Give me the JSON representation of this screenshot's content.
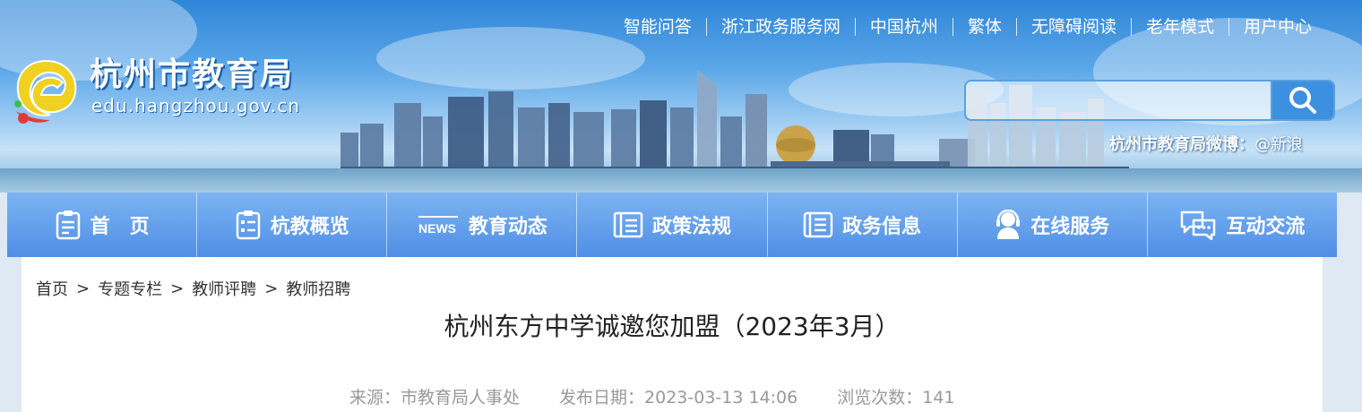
{
  "top_links": [
    "智能问答",
    "浙江政务服务网",
    "中国杭州",
    "繁体",
    "无障碍阅读",
    "老年模式",
    "用户中心"
  ],
  "logo": {
    "title": "杭州市教育局",
    "url": "edu.hangzhou.gov.cn"
  },
  "search": {
    "placeholder": "",
    "icon": "search-icon"
  },
  "weibo": {
    "label": "杭州市教育局微博：",
    "handle": "@新浪"
  },
  "nav": [
    {
      "label": "首　页",
      "icon": "home-doc-icon"
    },
    {
      "label": "杭教概览",
      "icon": "list-doc-icon"
    },
    {
      "label": "教育动态",
      "icon": "news-icon"
    },
    {
      "label": "政策法规",
      "icon": "book-icon"
    },
    {
      "label": "政务信息",
      "icon": "document-icon"
    },
    {
      "label": "在线服务",
      "icon": "headset-icon"
    },
    {
      "label": "互动交流",
      "icon": "chat-icon"
    }
  ],
  "breadcrumb": [
    "首页",
    "专题专栏",
    "教师评聘",
    "教师招聘"
  ],
  "article": {
    "title": "杭州东方中学诚邀您加盟（2023年3月）",
    "source": "来源：市教育局人事处",
    "date": "发布日期：2023-03-13 14:06",
    "views": "浏览次数：141"
  },
  "colors": {
    "nav_top": "#7cb4f2",
    "nav_bottom": "#4f8ee6",
    "sky": "#2f86d8"
  }
}
